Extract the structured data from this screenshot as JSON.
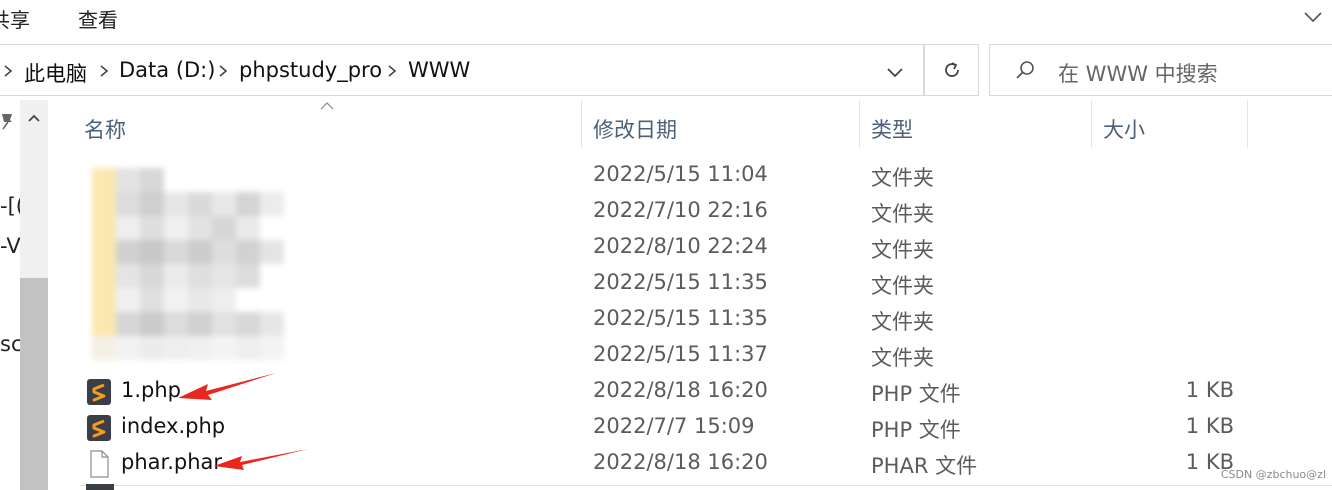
{
  "ribbon": {
    "tab_share": "共享",
    "tab_view": "查看"
  },
  "address": {
    "crumbs": [
      "此电脑",
      "Data (D:)",
      "phpstudy_pro",
      "WWW"
    ]
  },
  "search": {
    "placeholder": "在 WWW 中搜索"
  },
  "nav": {
    "cut_labels": [
      "-[(",
      "-V",
      "sc"
    ]
  },
  "columns": {
    "name": "名称",
    "date": "修改日期",
    "type": "类型",
    "size": "大小"
  },
  "files": [
    {
      "name": "",
      "date": "2022/5/15 11:04",
      "type": "文件夹",
      "size": "",
      "icon": "folder-icon"
    },
    {
      "name": "",
      "date": "2022/7/10 22:16",
      "type": "文件夹",
      "size": "",
      "icon": "folder-icon"
    },
    {
      "name": "",
      "date": "2022/8/10 22:24",
      "type": "文件夹",
      "size": "",
      "icon": "folder-icon"
    },
    {
      "name": "",
      "date": "2022/5/15 11:35",
      "type": "文件夹",
      "size": "",
      "icon": "folder-icon"
    },
    {
      "name": "",
      "date": "2022/5/15 11:35",
      "type": "文件夹",
      "size": "",
      "icon": "folder-icon"
    },
    {
      "name": "",
      "date": "2022/5/15 11:37",
      "type": "文件夹",
      "size": "",
      "icon": "folder-icon"
    },
    {
      "name": "1.php",
      "date": "2022/8/18 16:20",
      "type": "PHP 文件",
      "size": "1 KB",
      "icon": "sublime-php-icon"
    },
    {
      "name": "index.php",
      "date": "2022/7/7 15:09",
      "type": "PHP 文件",
      "size": "1 KB",
      "icon": "sublime-php-icon"
    },
    {
      "name": "phar.phar",
      "date": "2022/8/18 16:20",
      "type": "PHAR 文件",
      "size": "1 KB",
      "icon": "blank-file-icon"
    }
  ],
  "watermark": "CSDN @zbchuo@zl",
  "colors": {
    "accent_arrow": "#e8271d",
    "header_text": "#4c607a",
    "sublime_orange": "#f39c1f"
  }
}
